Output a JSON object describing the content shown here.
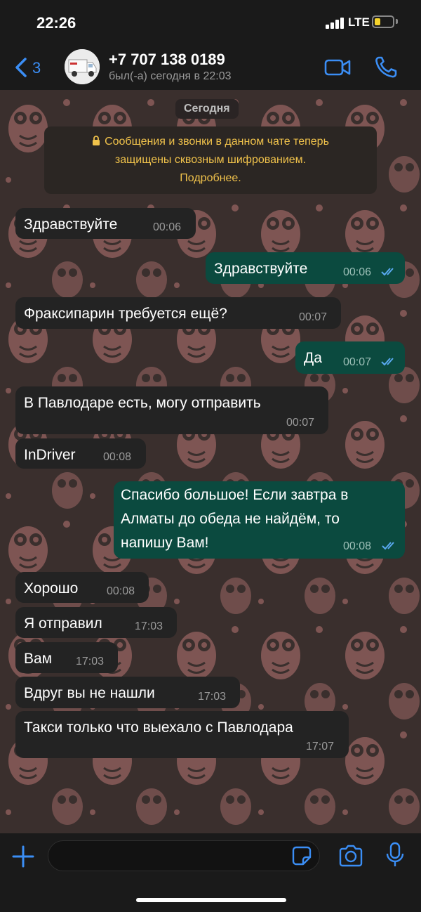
{
  "status_bar": {
    "time": "22:26",
    "network": "LTE"
  },
  "header": {
    "back_count": "3",
    "contact_name": "+7 707 138 0189",
    "last_seen": "был(-а) сегодня в 22:03"
  },
  "chat": {
    "date_label": "Сегодня",
    "encryption_notice": {
      "line1": "Сообщения и звонки в данном чате теперь",
      "line2": "защищены сквозным шифрованием.",
      "link": "Подробнее."
    },
    "messages": [
      {
        "dir": "in",
        "text": "Здравствуйте",
        "time": "00:06"
      },
      {
        "dir": "out",
        "text": "Здравствуйте",
        "time": "00:06",
        "read": true
      },
      {
        "dir": "in",
        "text": "Фраксипарин требуется ещё?",
        "time": "00:07"
      },
      {
        "dir": "out",
        "text": "Да",
        "time": "00:07",
        "read": true
      },
      {
        "dir": "in",
        "text": "В Павлодаре есть, могу отправить",
        "time": "00:07"
      },
      {
        "dir": "in",
        "text": "InDriver",
        "time": "00:08"
      },
      {
        "dir": "out",
        "lines": [
          "Спасибо большое! Если завтра в",
          "Алматы до обеда не найдём, то",
          "напишу Вам!"
        ],
        "time": "00:08",
        "read": true
      },
      {
        "dir": "in",
        "text": "Хорошо",
        "time": "00:08"
      },
      {
        "dir": "in",
        "text": "Я отправил",
        "time": "17:03"
      },
      {
        "dir": "in",
        "text": "Вам",
        "time": "17:03"
      },
      {
        "dir": "in",
        "text": "Вдруг вы не нашли",
        "time": "17:03"
      },
      {
        "dir": "in",
        "text": "Такси только что выехало с Павлодара",
        "time": "17:07"
      }
    ]
  },
  "input_bar": {
    "message_value": ""
  },
  "colors": {
    "accent": "#3b8ef5",
    "incoming_bubble": "#232323",
    "outgoing_bubble": "#0b4a3f",
    "notice_text": "#f0c24b",
    "read_check": "#5aa9f0"
  },
  "icons": {
    "back": "chevron-left-icon",
    "video": "video-camera-icon",
    "call": "phone-icon",
    "attach": "plus-icon",
    "sticker": "sticker-icon",
    "camera": "camera-icon",
    "mic": "microphone-icon",
    "lock": "lock-icon",
    "read": "double-check-icon"
  }
}
